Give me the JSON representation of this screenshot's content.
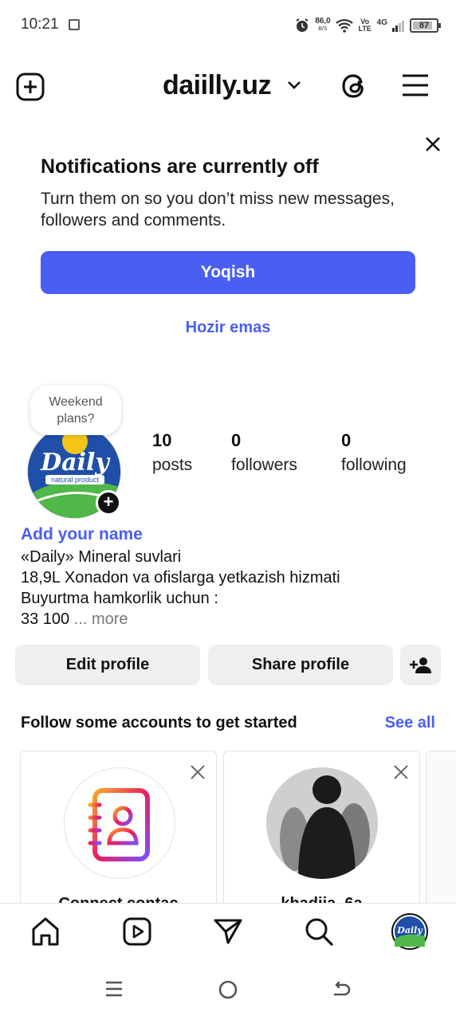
{
  "status": {
    "time": "10:21",
    "net_speed": "86,0",
    "net_unit": "B/S",
    "volte": "Vo LTE",
    "network": "4G",
    "battery": "87",
    "battery_level": 0.87
  },
  "header": {
    "account_name": "daiilly.uz",
    "icons": [
      "new-post-icon",
      "chevron-down-icon",
      "threads-icon",
      "menu-icon"
    ]
  },
  "notification": {
    "title": "Notifications are currently off",
    "body": "Turn them on so you don’t miss new messages, followers and comments.",
    "primary_button": "Yoqish",
    "secondary_button": "Hozir emas"
  },
  "profile": {
    "note": "Weekend plans?",
    "avatar_text": "Daily",
    "avatar_subtext": "natural product",
    "stats": [
      {
        "value": "10",
        "label": "posts"
      },
      {
        "value": "0",
        "label": "followers"
      },
      {
        "value": "0",
        "label": "following"
      }
    ],
    "add_name": "Add your name",
    "bio_lines": [
      "«Daily» Mineral suvlari",
      "18,9L Xonadon va ofislarga yetkazish hizmati",
      "Buyurtma hamkorlik uchun :"
    ],
    "bio_last": "33 100",
    "bio_more": "... more",
    "edit_button": "Edit profile",
    "share_button": "Share profile"
  },
  "suggestions": {
    "title": "Follow some accounts to get started",
    "see_all": "See all",
    "cards": [
      {
        "label": "Connect contac"
      },
      {
        "label": "khadija_6a"
      }
    ]
  },
  "colors": {
    "accent": "#4a5ef4",
    "button_gray": "#efeff2"
  }
}
